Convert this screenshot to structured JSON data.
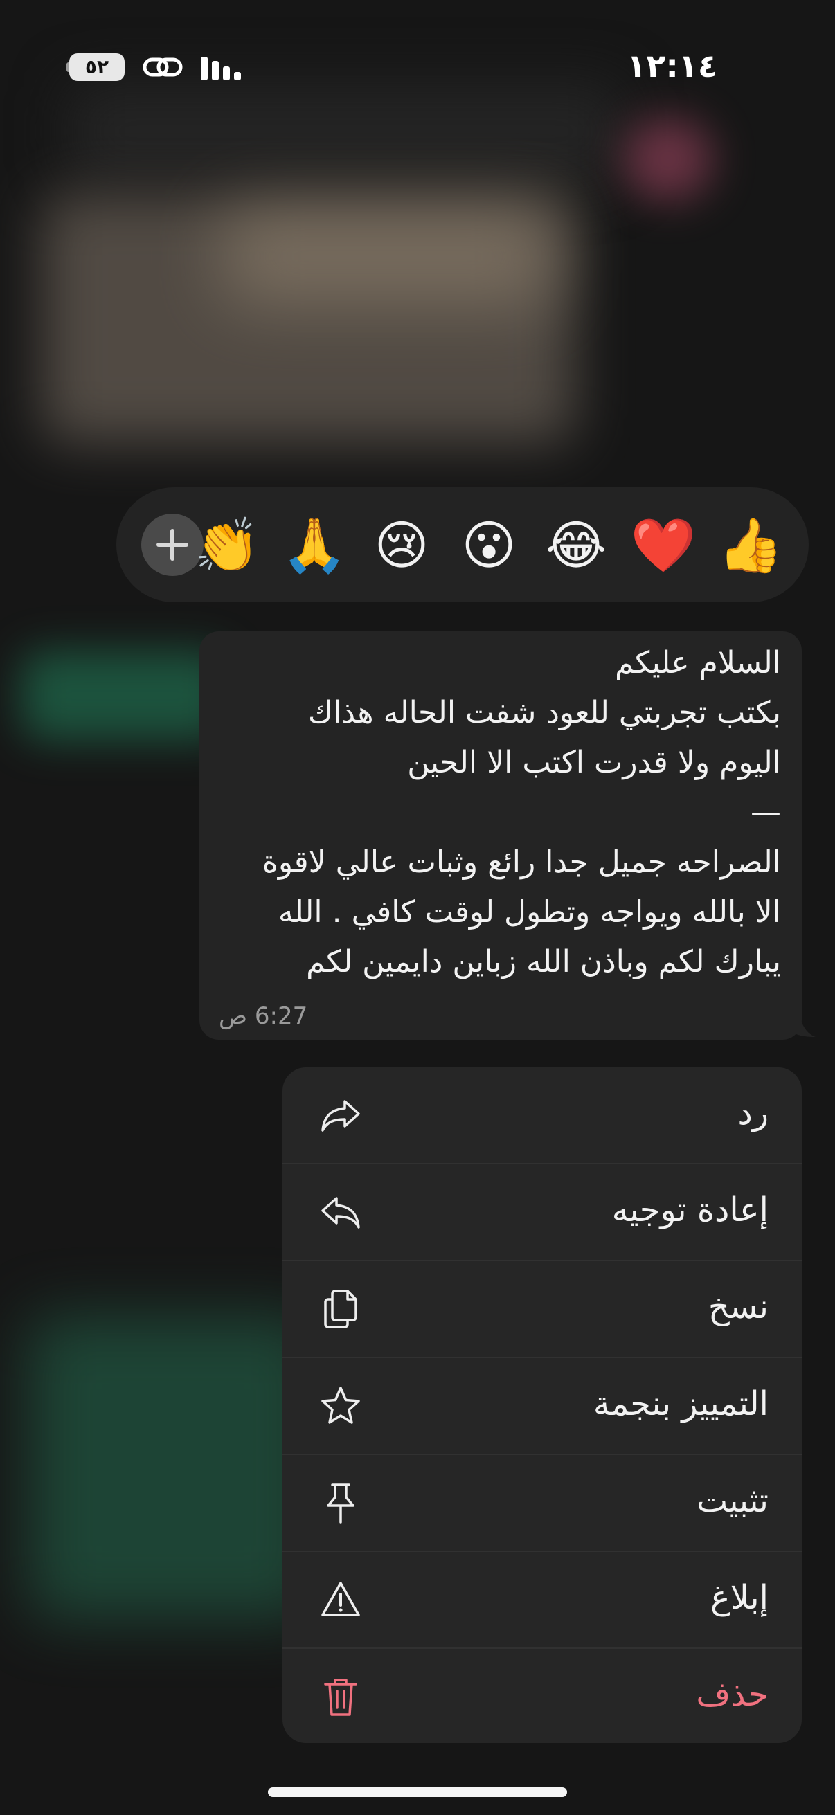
{
  "status_bar": {
    "time": "١٢:١٤",
    "battery": "٥٢"
  },
  "reactions": {
    "emojis": [
      "👍",
      "❤️",
      "😂",
      "😮",
      "😢",
      "🙏",
      "👏"
    ],
    "add_icon": "plus-icon"
  },
  "message": {
    "lines": [
      "السلام عليكم",
      "بكتب تجربتي للعود شفت الحاله هذاك",
      "اليوم ولا قدرت اكتب الا الحين",
      "—",
      "الصراحه جميل جدا رائع وثبات عالي لاقوة",
      "الا بالله ويواجه وتطول  لوقت كافي . الله",
      "يبارك لكم وباذن الله زباين دايمين لكم"
    ],
    "time": "6:27 ص"
  },
  "menu": {
    "items": [
      {
        "label": "رد",
        "icon": "reply-icon"
      },
      {
        "label": "إعادة توجيه",
        "icon": "forward-icon"
      },
      {
        "label": "نسخ",
        "icon": "copy-icon"
      },
      {
        "label": "التمييز بنجمة",
        "icon": "star-icon"
      },
      {
        "label": "تثبيت",
        "icon": "pin-icon"
      },
      {
        "label": "إبلاغ",
        "icon": "warning-icon"
      },
      {
        "label": "حذف",
        "icon": "trash-icon"
      }
    ],
    "danger_color": "#f0717f"
  }
}
